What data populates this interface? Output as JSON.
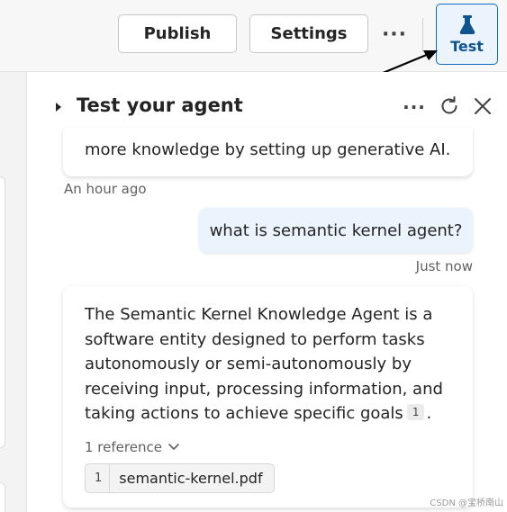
{
  "toolbar": {
    "publish_label": "Publish",
    "settings_label": "Settings",
    "more_label": "···",
    "test_label": "Test"
  },
  "panel": {
    "title": "Test your agent",
    "more_label": "···"
  },
  "messages": {
    "bot_previous": {
      "text": "more knowledge by setting up generative AI.",
      "timestamp": "An hour ago"
    },
    "user": {
      "text": "what is semantic kernel agent?",
      "timestamp": "Just now"
    },
    "bot_answer": {
      "text": "The Semantic Kernel Knowledge Agent is a software entity designed to perform tasks autonomously or semi-autonomously by receiving input, processing information, and taking actions to achieve specific goals",
      "citation_number": "1",
      "end_punctuation": ".",
      "reference_toggle": "1 reference",
      "reference": {
        "number": "1",
        "file_name": "semantic-kernel.pdf"
      }
    }
  },
  "watermark": "CSDN @宝桥南山",
  "icons": {
    "test": "flask-icon",
    "collapse": "caret-right-icon",
    "refresh": "refresh-icon",
    "close": "close-icon",
    "reference_toggle": "chevron-down-icon",
    "annotation": "arrow-icon"
  },
  "colors": {
    "accent": "#0f6cbd",
    "test_button_bg": "#ebf3fc",
    "user_bubble_bg": "#ebf3fc",
    "toolbar_bg": "#f7f7f7"
  }
}
